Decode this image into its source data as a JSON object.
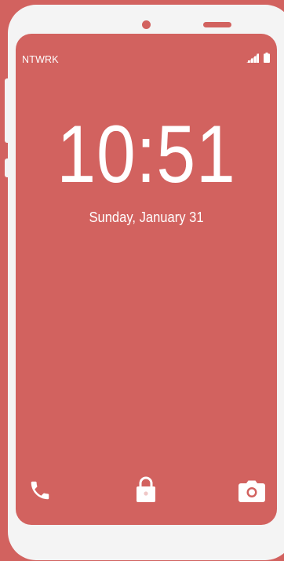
{
  "status_bar": {
    "carrier": "NTWRK",
    "signal_icon": "signal-icon",
    "battery_icon": "battery-icon"
  },
  "lock_screen": {
    "time": "10:51",
    "date": "Sunday, January 31"
  },
  "shortcuts": {
    "left_icon": "phone-icon",
    "center_icon": "lock-icon",
    "right_icon": "camera-icon"
  },
  "colors": {
    "accent": "#d2625f",
    "device_frame": "#f4f4f4",
    "text": "#ffffff"
  }
}
